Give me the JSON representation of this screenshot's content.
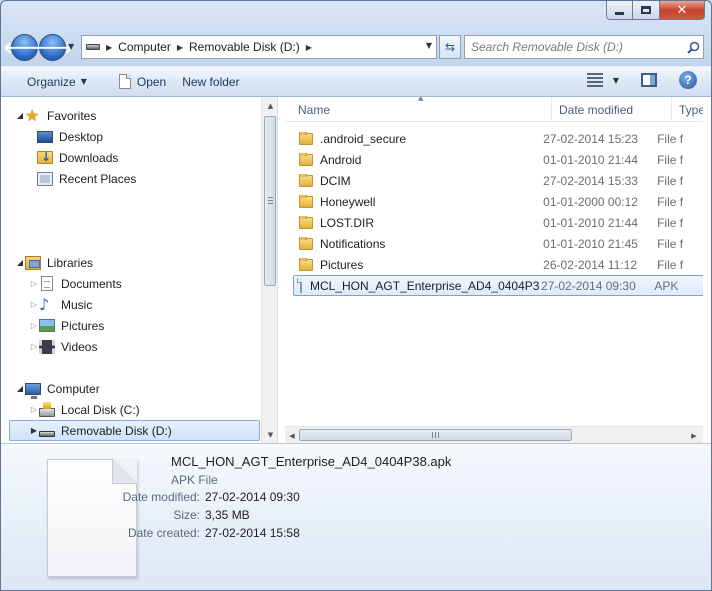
{
  "window": {
    "caption": {
      "close_glyph": "✕"
    }
  },
  "navbar": {
    "back_arrow": "🡐",
    "forward_arrow": "🡒",
    "breadcrumb": [
      "Computer",
      "Removable Disk (D:)"
    ],
    "search_placeholder": "Search Removable Disk (D:)"
  },
  "toolbar": {
    "organize_label": "Organize",
    "open_label": "Open",
    "new_folder_label": "New folder",
    "help_label": "?"
  },
  "nav_pane": {
    "favorites": {
      "label": "Favorites",
      "items": [
        "Desktop",
        "Downloads",
        "Recent Places"
      ]
    },
    "libraries": {
      "label": "Libraries",
      "items": [
        "Documents",
        "Music",
        "Pictures",
        "Videos"
      ]
    },
    "computer": {
      "label": "Computer",
      "items": [
        "Local Disk (C:)",
        "Removable Disk (D:)"
      ]
    },
    "selected": "Removable Disk (D:)"
  },
  "file_list": {
    "columns": [
      "Name",
      "Date modified",
      "Type"
    ],
    "rows": [
      {
        "name": ".android_secure",
        "date": "27-02-2014 15:23",
        "type": "File f",
        "kind": "folder"
      },
      {
        "name": "Android",
        "date": "01-01-2010 21:44",
        "type": "File f",
        "kind": "folder"
      },
      {
        "name": "DCIM",
        "date": "27-02-2014 15:33",
        "type": "File f",
        "kind": "folder"
      },
      {
        "name": "Honeywell",
        "date": "01-01-2000 00:12",
        "type": "File f",
        "kind": "folder"
      },
      {
        "name": "LOST.DIR",
        "date": "01-01-2010 21:44",
        "type": "File f",
        "kind": "folder"
      },
      {
        "name": "Notifications",
        "date": "01-01-2010 21:45",
        "type": "File f",
        "kind": "folder"
      },
      {
        "name": "Pictures",
        "date": "26-02-2014 11:12",
        "type": "File f",
        "kind": "folder"
      },
      {
        "name": "MCL_HON_AGT_Enterprise_AD4_0404P38...",
        "date": "27-02-2014 09:30",
        "type": "APK",
        "kind": "file",
        "selected": true
      }
    ]
  },
  "details": {
    "title": "MCL_HON_AGT_Enterprise_AD4_0404P38.apk",
    "type": "APK File",
    "date_modified_label": "Date modified:",
    "date_modified": "27-02-2014 09:30",
    "size_label": "Size:",
    "size": "3,35 MB",
    "date_created_label": "Date created:",
    "date_created": "27-02-2014 15:58"
  },
  "colors": {
    "selection": "#cfe3f9",
    "chrome": "#c4d6ec",
    "accent": "#1d57a7"
  }
}
